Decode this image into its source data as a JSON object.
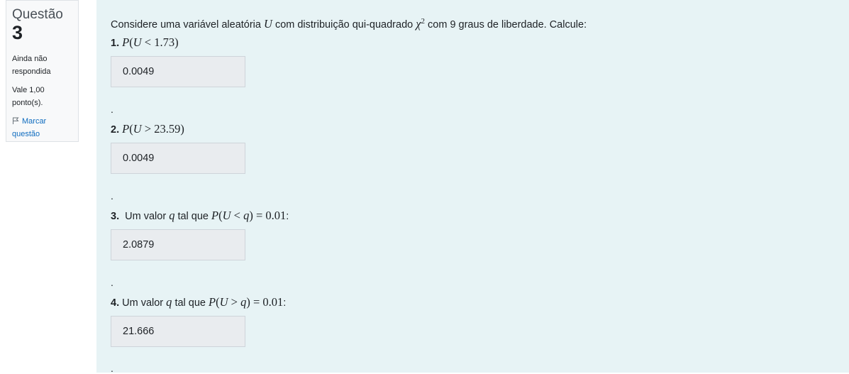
{
  "info": {
    "question_label": "Questão",
    "question_number": "3",
    "status_line1": "Ainda não",
    "status_line2": "respondida",
    "grade_line1": "Vale 1,00",
    "grade_line2": "ponto(s).",
    "flag_line1": "Marcar",
    "flag_line2": "questão",
    "flag_icon": "flag-icon"
  },
  "question": {
    "intro_prefix": "Considere uma variável aleatória ",
    "intro_var": "U",
    "intro_middle": " com distribuição qui-quadrado ",
    "intro_chi": "χ",
    "intro_sup": "2",
    "intro_suffix_num": " com 9",
    "intro_suffix": " graus de liberdade. Calcule:",
    "parts": [
      {
        "number": "1.",
        "text": "",
        "expr_p": "P",
        "expr_open": "(",
        "expr_var": "U",
        "expr_op": " < ",
        "expr_rhs": "1.73",
        "expr_close": ")",
        "expr_tail": "",
        "answer": "0.0049",
        "dot": "."
      },
      {
        "number": "2.",
        "text": "",
        "expr_p": "P",
        "expr_open": "(",
        "expr_var": "U",
        "expr_op": " > ",
        "expr_rhs": "23.59",
        "expr_close": ")",
        "expr_tail": "",
        "answer": "0.0049",
        "dot": "."
      },
      {
        "number": "3.",
        "text_a": "  Um valor ",
        "q": "q",
        "text_b": " tal que ",
        "expr_p": "P",
        "expr_open": "(",
        "expr_var": "U",
        "expr_op": " < ",
        "expr_q": "q",
        "expr_close": ")",
        "expr_eq": " = 0.01",
        "expr_tail": ":",
        "answer": "2.0879",
        "dot": "."
      },
      {
        "number": "4.",
        "text_a": " Um valor ",
        "q": "q",
        "text_b": " tal que ",
        "expr_p": "P",
        "expr_open": "(",
        "expr_var": "U",
        "expr_op": " > ",
        "expr_q": "q",
        "expr_close": ")",
        "expr_eq": " = 0.01",
        "expr_tail": ":",
        "answer": "21.666",
        "dot": "."
      }
    ]
  }
}
